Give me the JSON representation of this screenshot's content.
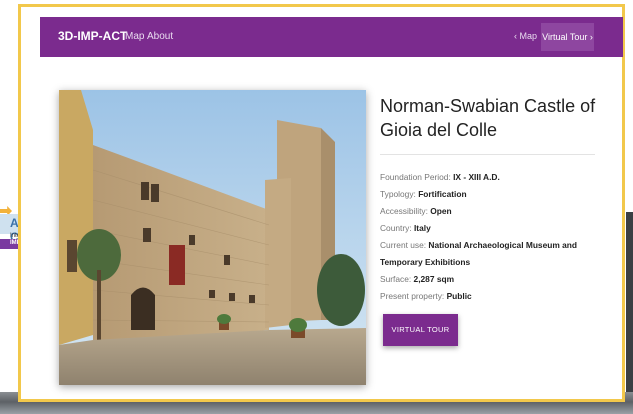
{
  "navbar": {
    "brand": "3D-IMP-ACT",
    "map": "Map",
    "about": "About",
    "prev": "‹ Map",
    "next": "Virtual Tour ›"
  },
  "site": {
    "title": "Norman-Swabian Castle of Gioia del Colle",
    "details": [
      {
        "label": "Foundation Period: ",
        "value": "IX - XIII A.D."
      },
      {
        "label": "Typology: ",
        "value": "Fortification"
      },
      {
        "label": "Accessibility: ",
        "value": "Open"
      },
      {
        "label": "Country: ",
        "value": "Italy"
      },
      {
        "label": "Current use: ",
        "value": "National Archaeological Museum and Temporary Exhibitions"
      },
      {
        "label": "Surface: ",
        "value": "2,287 sqm"
      },
      {
        "label": "Present property: ",
        "value": "Public"
      }
    ],
    "button": "VIRTUAL TOUR"
  },
  "logo": {
    "line1": "A CBC",
    "line2": "Interregio",
    "line3": "IMP-ACT"
  },
  "colors": {
    "accent": "#7b2b8e",
    "frame": "#f2c84b"
  }
}
